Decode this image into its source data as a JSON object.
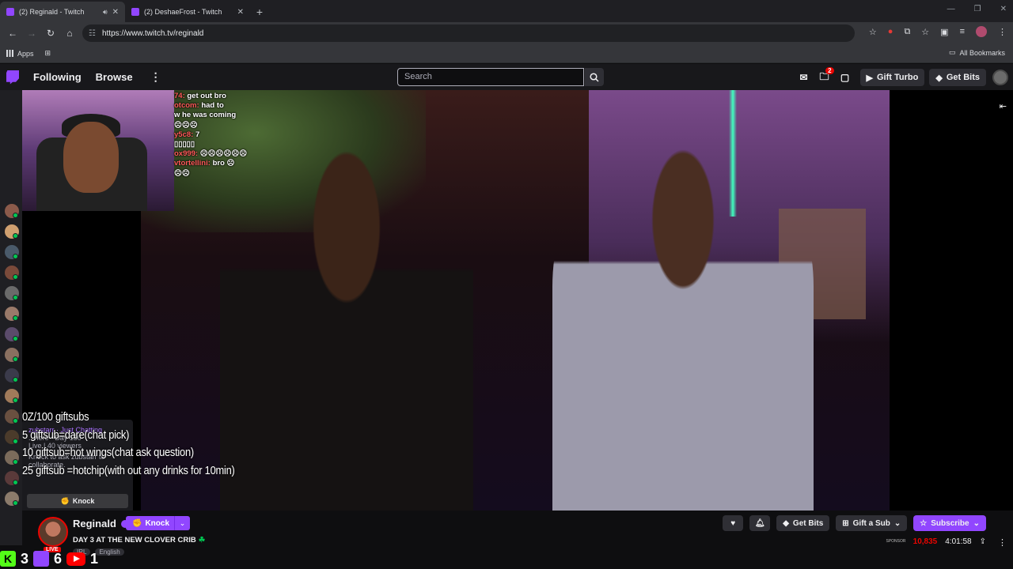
{
  "browser": {
    "tabs": [
      {
        "title": "(2) Reginald - Twitch",
        "active": true
      },
      {
        "title": "(2) DeshaeFrost - Twitch",
        "active": false
      }
    ],
    "url": "https://www.twitch.tv/reginald",
    "bookmarks": {
      "apps_label": "Apps",
      "all_bookmarks_label": "All Bookmarks"
    }
  },
  "twitch_nav": {
    "following_label": "Following",
    "browse_label": "Browse",
    "search_placeholder": "Search",
    "notifications_badge": "2",
    "gift_turbo_label": "Gift Turbo",
    "get_bits_label": "Get Bits"
  },
  "stream_overlay": {
    "chat_lines": [
      {
        "user": "74:",
        "msg": "get out bro"
      },
      {
        "user": "otcom:",
        "msg": "had to"
      },
      {
        "user": "",
        "msg": "w he was coming"
      },
      {
        "user": "",
        "msg": "☹☹☹"
      },
      {
        "user": "y5c8:",
        "msg": "7"
      },
      {
        "user": "",
        "msg": "▯▯▯▯▯"
      },
      {
        "user": "ox999:",
        "msg": "☹☹☹☹☹☹"
      },
      {
        "user": "vtortellini:",
        "msg": "bro ☹"
      },
      {
        "user": "",
        "msg": "☹☹"
      }
    ],
    "hype_lines": [
      "0Z/100 giftsubs",
      "5 giftsub=dare(chat pick)",
      "10 giftsub=hot wings(chat ask question)",
      "25 giftsub =hotchip(with out any drinks for 10min)"
    ],
    "raid_card": {
      "line1": "zubstarr · Just Chatting",
      "line2": "...here ~Day 150",
      "line3": "Live | 40 viewers",
      "line4": "Knock to ask zubstarr to collaborate.",
      "knock_label": "Knock"
    }
  },
  "channel": {
    "name": "Reginald",
    "knock_label": "Knock",
    "live_label": "LIVE",
    "title": "DAY 3 AT THE NEW CLOVER CRIB",
    "title_emoji": "☘",
    "tags": [
      "IRL",
      "English"
    ],
    "viewers": "10,835",
    "uptime": "4:01:58",
    "get_bits_label": "Get Bits",
    "gift_sub_label": "Gift a Sub",
    "subscribe_label": "Subscribe"
  },
  "platform_counts": {
    "kick": "3",
    "twitch": "6",
    "youtube": "1"
  },
  "colors": {
    "twitch_purple": "#9146ff",
    "live_red": "#eb0400",
    "online_green": "#00c853",
    "kick_green": "#53fc18"
  }
}
